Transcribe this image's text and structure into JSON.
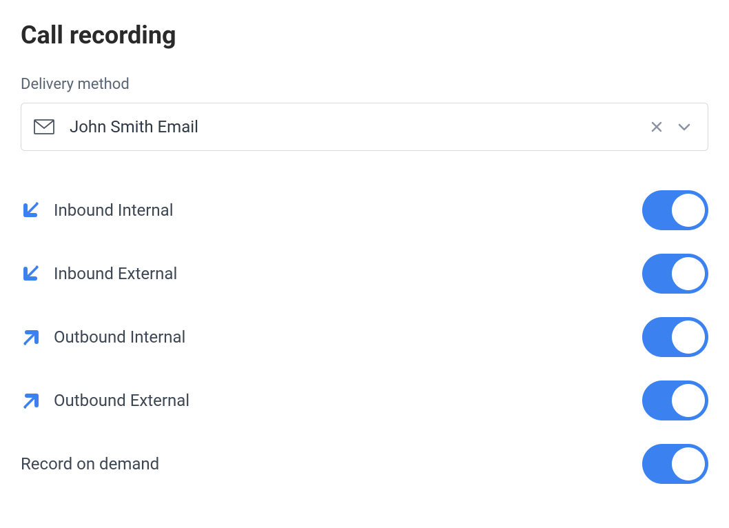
{
  "title": "Call recording",
  "delivery": {
    "label": "Delivery method",
    "value": "John Smith Email"
  },
  "settings": [
    {
      "key": "inbound-internal",
      "label": "Inbound Internal",
      "direction": "in",
      "toggled": true
    },
    {
      "key": "inbound-external",
      "label": "Inbound External",
      "direction": "in",
      "toggled": true
    },
    {
      "key": "outbound-internal",
      "label": "Outbound Internal",
      "direction": "out",
      "toggled": true
    },
    {
      "key": "outbound-external",
      "label": "Outbound External",
      "direction": "out",
      "toggled": true
    },
    {
      "key": "record-on-demand",
      "label": "Record on demand",
      "direction": null,
      "toggled": true
    }
  ]
}
